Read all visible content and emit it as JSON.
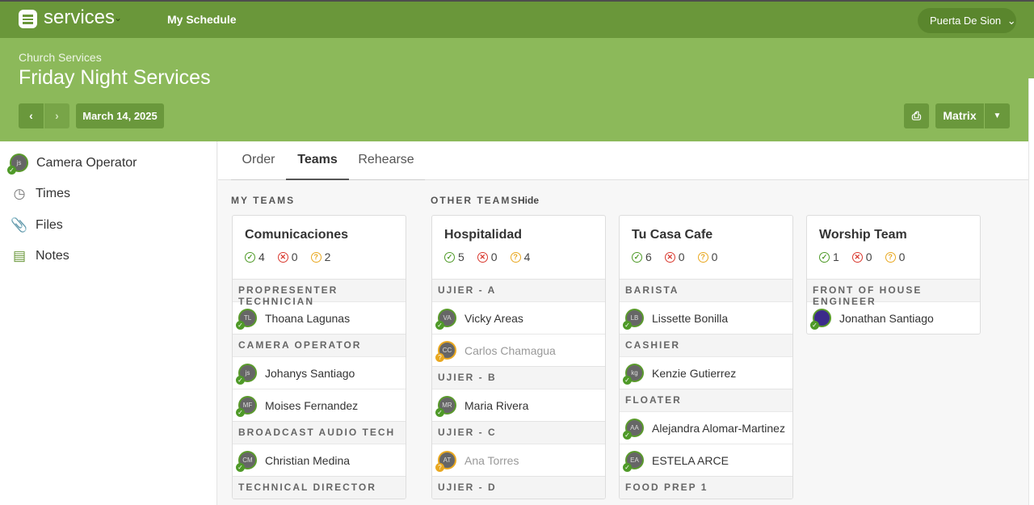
{
  "nav": {
    "brand": "services",
    "my_schedule": "My Schedule",
    "org": "Puerta De Sion"
  },
  "header": {
    "breadcrumb": "Church Services",
    "title": "Friday Night Services",
    "date": "March 14, 2025",
    "matrix": "Matrix"
  },
  "sidebar": {
    "items": [
      {
        "label": "Camera Operator",
        "icon": "avatar",
        "initials": "js"
      },
      {
        "label": "Times",
        "icon": "clock-icon"
      },
      {
        "label": "Files",
        "icon": "paperclip-icon"
      },
      {
        "label": "Notes",
        "icon": "notes-icon"
      }
    ]
  },
  "tabs": [
    "Order",
    "Teams",
    "Rehearse"
  ],
  "sections": {
    "my_teams": "MY TEAMS",
    "other_teams": "OTHER TEAMS",
    "hide": "Hide"
  },
  "colors": {
    "accent": "#6a973a",
    "header": "#8cb95a",
    "confirmed": "#4f9a28",
    "declined": "#d9382e",
    "pending": "#e9a820"
  },
  "teams": [
    {
      "name": "Comunicaciones",
      "confirmed": "4",
      "declined": "0",
      "pending": "2",
      "rows": [
        {
          "role": "PROPRESENTER TECHNICIAN"
        },
        {
          "name": "Thoana Lagunas",
          "initials": "TL",
          "status": "confirmed"
        },
        {
          "role": "CAMERA OPERATOR"
        },
        {
          "name": "Johanys Santiago",
          "initials": "js",
          "status": "confirmed"
        },
        {
          "name": "Moises Fernandez",
          "initials": "MF",
          "status": "confirmed"
        },
        {
          "role": "BROADCAST AUDIO TECH"
        },
        {
          "name": "Christian Medina",
          "initials": "CM",
          "status": "confirmed"
        },
        {
          "role": "TECHNICAL DIRECTOR"
        }
      ]
    },
    {
      "name": "Hospitalidad",
      "confirmed": "5",
      "declined": "0",
      "pending": "4",
      "rows": [
        {
          "role": "UJIER - A"
        },
        {
          "name": "Vicky Areas",
          "initials": "VA",
          "status": "confirmed"
        },
        {
          "name": "Carlos Chamagua",
          "initials": "CC",
          "status": "pending"
        },
        {
          "role": "UJIER - B"
        },
        {
          "name": "Maria Rivera",
          "initials": "MR",
          "status": "confirmed"
        },
        {
          "role": "UJIER - C"
        },
        {
          "name": "Ana Torres",
          "initials": "AT",
          "status": "pending"
        },
        {
          "role": "UJIER - D"
        }
      ]
    },
    {
      "name": "Tu Casa Cafe",
      "confirmed": "6",
      "declined": "0",
      "pending": "0",
      "rows": [
        {
          "role": "BARISTA"
        },
        {
          "name": "Lissette Bonilla",
          "initials": "LB",
          "status": "confirmed"
        },
        {
          "role": "CASHIER"
        },
        {
          "name": "Kenzie Gutierrez",
          "initials": "kg",
          "status": "confirmed"
        },
        {
          "role": "FLOATER"
        },
        {
          "name": "Alejandra Alomar-Martinez",
          "initials": "AA",
          "status": "confirmed"
        },
        {
          "name": "ESTELA ARCE",
          "initials": "EA",
          "status": "confirmed"
        },
        {
          "role": "FOOD PREP 1"
        }
      ]
    },
    {
      "name": "Worship Team",
      "confirmed": "1",
      "declined": "0",
      "pending": "0",
      "rows": [
        {
          "role": "FRONT OF HOUSE ENGINEER"
        },
        {
          "name": "Jonathan Santiago",
          "initials": "",
          "status": "confirmed"
        }
      ]
    }
  ]
}
